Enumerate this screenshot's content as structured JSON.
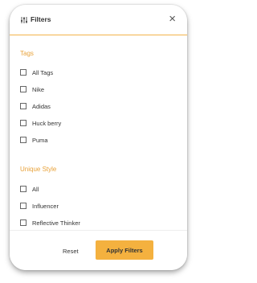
{
  "header": {
    "title": "Filters",
    "close_symbol": "×"
  },
  "sections": {
    "tags": {
      "title": "Tags",
      "options": [
        "All Tags",
        "Nike",
        "Adidas",
        "Huck berry",
        "Puma"
      ]
    },
    "unique_style": {
      "title": "Unique Style",
      "options": [
        "All",
        "Influencer",
        "Reflective Thinker"
      ]
    }
  },
  "footer": {
    "reset_label": "Reset",
    "apply_label": "Apply Filters"
  },
  "colors": {
    "accent": "#f4b13f",
    "section_title": "#e8a23a"
  },
  "icons": {
    "header": "filter-sliders-icon",
    "close": "close-icon"
  }
}
